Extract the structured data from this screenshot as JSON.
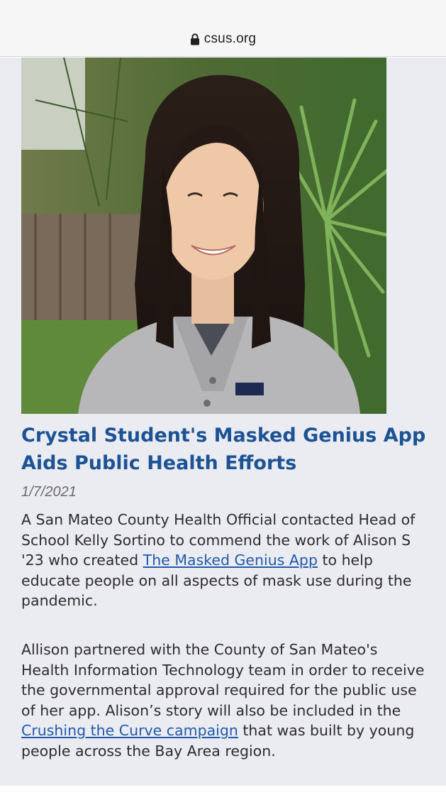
{
  "browser": {
    "url": "csus.org",
    "icon": "lock-icon"
  },
  "article": {
    "photo_icon": "student-portrait",
    "headline": "Crystal Student's Masked Genius App Aids Public Health Efforts",
    "date": "1/7/2021",
    "paragraph1": {
      "text_before": "A San Mateo County Health Official contacted Head of School Kelly Sortino to commend the work of Alison S '23 who created ",
      "link": "The Masked Genius App",
      "text_after": " to help educate people on all aspects of mask use during the pandemic."
    },
    "paragraph2": {
      "text_before": "Allison partnered with the County of San Mateo's Health Information Technology team in order to receive the governmental approval required for the public use of her app. Alison’s story will also be included in the ",
      "link": "Crushing the Curve campaign",
      "text_after": " that was built by young people across the Bay Area region."
    }
  },
  "colors": {
    "headline": "#1c5394",
    "link": "#1f5ba8",
    "content_bg": "#ebebf2"
  }
}
